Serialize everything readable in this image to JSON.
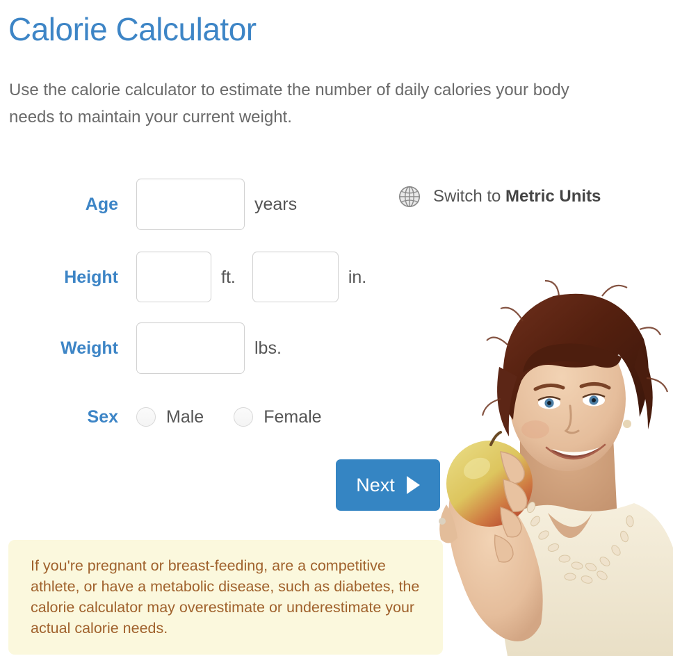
{
  "header": {
    "title": "Calorie Calculator",
    "subtitle": "Use the calorie calculator to estimate the number of daily calories your body needs to maintain your current weight."
  },
  "form": {
    "age": {
      "label": "Age",
      "value": "",
      "placeholder": "",
      "unit": "years"
    },
    "height": {
      "label": "Height",
      "feet_value": "",
      "feet_placeholder": "",
      "feet_unit": "ft.",
      "inches_value": "",
      "inches_placeholder": "",
      "inches_unit": "in."
    },
    "weight": {
      "label": "Weight",
      "value": "",
      "placeholder": "",
      "unit": "lbs."
    },
    "sex": {
      "label": "Sex",
      "options": [
        {
          "label": "Male",
          "selected": false
        },
        {
          "label": "Female",
          "selected": false
        }
      ]
    }
  },
  "unit_switch": {
    "icon": "globe-icon",
    "prefix": "Switch to ",
    "emphasis": "Metric Units"
  },
  "next_button": {
    "label": "Next",
    "icon": "play-arrow-icon"
  },
  "warning": {
    "text": "If you're pregnant or breast-feeding, are a competitive athlete, or have a metabolic disease, such as diabetes, the calorie calculator may overestimate or underestimate your actual calorie needs."
  },
  "photo": {
    "alt": "Smiling woman with short auburn hair holding an apple"
  },
  "colors": {
    "accent_blue": "#3d85c6",
    "button_blue": "#3585c3",
    "label_blue": "#3d85c6",
    "body_gray": "#6a6a6a",
    "warning_bg": "#fbf8dd",
    "warning_text": "#a0622d",
    "input_border": "#d2d2d2"
  }
}
